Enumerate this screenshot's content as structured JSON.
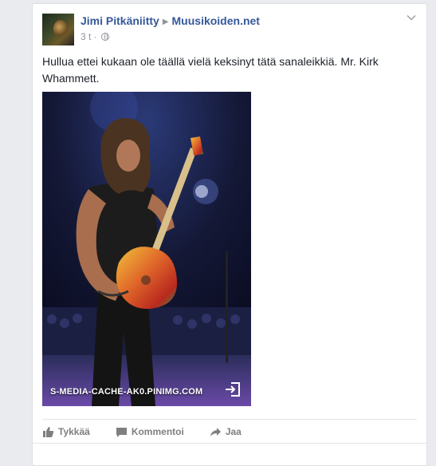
{
  "post": {
    "author": "Jimi Pitkäniitty",
    "group": "Muusikoiden.net",
    "time": "3 t",
    "text": "Hullua ettei kukaan ole täällä vielä keksinyt tätä sanaleikkiä. Mr. Kirk Whammett.",
    "image_source": "S-MEDIA-CACHE-AK0.PINIMG.COM",
    "icons": {
      "chevron": "chevron-down-icon",
      "globe": "globe-icon",
      "open_link": "open-link-icon",
      "like": "thumbs-up-icon",
      "comment": "comment-icon",
      "share": "share-arrow-icon"
    }
  },
  "actions": {
    "like": "Tykkää",
    "comment": "Kommentoi",
    "share": "Jaa"
  },
  "colors": {
    "link": "#365899",
    "meta": "#90949c",
    "action": "#7f7f7f",
    "background": "#e9ebee"
  }
}
